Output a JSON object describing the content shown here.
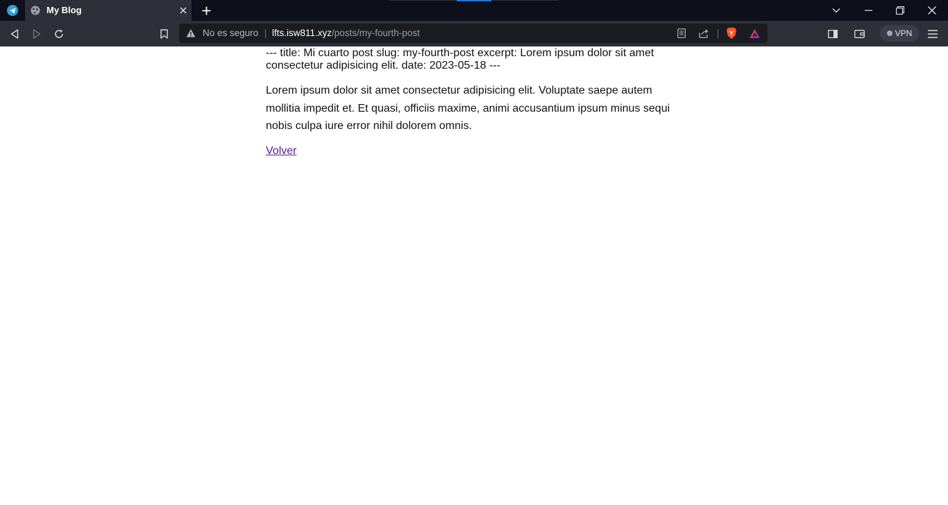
{
  "browser": {
    "tab": {
      "title": "My Blog"
    },
    "address_bar": {
      "security_label": "No es seguro",
      "url_host": "lfts.isw811.xyz",
      "url_path": "/posts/my-fourth-post"
    },
    "vpn_label": "VPN",
    "colors": {
      "tabbar": "#0d0f1a",
      "toolbar": "#2d3039",
      "omnibox": "#1b1c22",
      "accent": "#2277d6",
      "brave_orange": "#fb542b"
    }
  },
  "page": {
    "frontmatter_text": "--- title: Mi cuarto post slug: my-fourth-post excerpt: Lorem ipsum dolor sit amet consectetur adipisicing elit. date: 2023-05-18 ---",
    "body_text": "Lorem ipsum dolor sit amet consectetur adipisicing elit. Voluptate saepe autem mollitia impedit et. Et quasi, officiis maxime, animi accusantium ipsum minus sequi nobis culpa iure error nihil dolorem omnis.",
    "back_link_label": "Volver"
  }
}
